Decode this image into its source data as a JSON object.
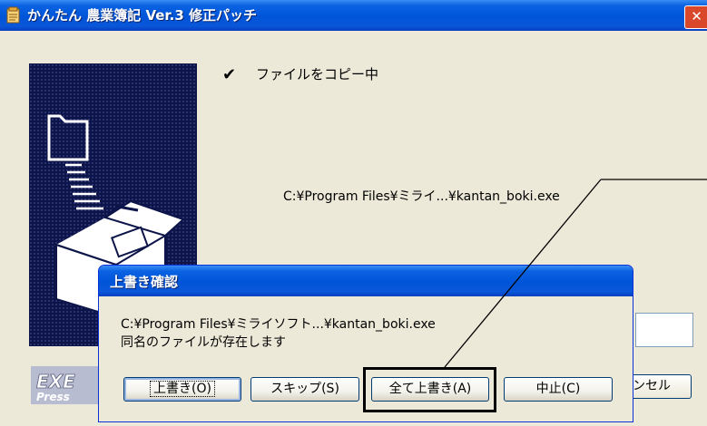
{
  "main_window": {
    "title": "かんたん 農業簿記 Ver.3 修正パッチ",
    "close_label": "✕",
    "status_text": "ファイルをコピー中",
    "check_glyph": "✔",
    "target_path": "C:¥Program Files¥ミライ...¥kantan_boki.exe",
    "cancel_label": "ンセル",
    "logo_text_top": "EXE",
    "logo_text_bottom": "Press"
  },
  "dialog": {
    "title": "上書き確認",
    "path": "C:¥Program Files¥ミライソフト...¥kantan_boki.exe",
    "message": "同名のファイルが存在します",
    "buttons": {
      "overwrite": "上書き(O)",
      "skip": "スキップ(S)",
      "overwrite_all": "全て上書き(A)",
      "cancel": "中止(C)"
    }
  },
  "colors": {
    "titlebar": "#0054d8",
    "panel": "#0c1449",
    "close": "#d9482a",
    "window_bg": "#ece9d8"
  },
  "icons": [
    "app-icon",
    "close-icon",
    "checkmark-icon",
    "folder-into-box-illustration",
    "exe-press-logo"
  ]
}
